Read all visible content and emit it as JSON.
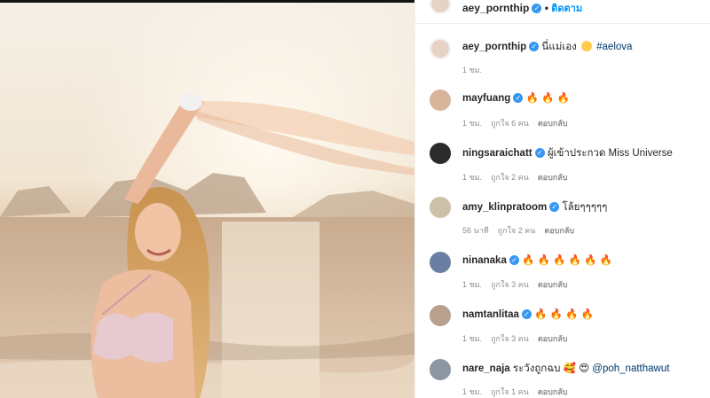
{
  "post": {
    "author": "aey_pornthip",
    "follow_label": "ติดตาม",
    "caption_user": "aey_pornthip",
    "caption_text": "นี่แม่เอง",
    "caption_tag": "#aelova",
    "caption_time": "1 ชม."
  },
  "comments": [
    {
      "user": "mayfuang",
      "text": "🔥 🔥 🔥",
      "time": "1 ชม.",
      "likes": "ถูกใจ 6 คน",
      "reply": "ตอบกลับ"
    },
    {
      "user": "ningsaraichatt",
      "text": "ผู้เข้าประกวด Miss Universe",
      "time": "1 ชม.",
      "likes": "ถูกใจ 2 คน",
      "reply": "ตอบกลับ"
    },
    {
      "user": "amy_klinpratoom",
      "text": "โล้ยๆๆๆๆๆ",
      "time": "56 นาที",
      "likes": "ถูกใจ 2 คน",
      "reply": "ตอบกลับ"
    },
    {
      "user": "ninanaka",
      "text": "🔥 🔥 🔥 🔥 🔥 🔥",
      "time": "1 ชม.",
      "likes": "ถูกใจ 3 คน",
      "reply": "ตอบกลับ"
    },
    {
      "user": "namtanlitaa",
      "text": "🔥 🔥 🔥 🔥",
      "time": "1 ชม.",
      "likes": "ถูกใจ 3 คน",
      "reply": "ตอบกลับ"
    },
    {
      "user": "nare_naja",
      "text": "ระวังถูกฉบ 🥰 😍",
      "mention": "@poh_natthawut",
      "time": "1 ชม.",
      "likes": "ถูกใจ 1 คน",
      "reply": "ตอบกลับ"
    }
  ],
  "colors": {
    "link": "#0095f6",
    "verified": "#3897f0",
    "text": "#262626",
    "muted": "#8e8e8e"
  }
}
